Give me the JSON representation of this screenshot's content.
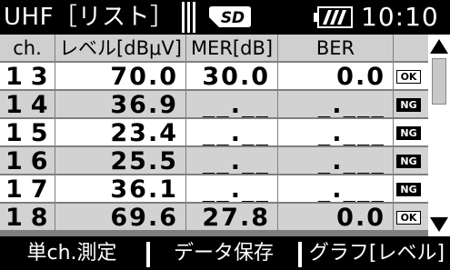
{
  "status_bar": {
    "title": "UHF［リスト］",
    "storage_icon": "sd-card-icon",
    "storage_label": "SD",
    "signal_icon": "signal-bars-icon",
    "battery_icon": "battery-icon",
    "time": "10:10"
  },
  "table": {
    "headers": [
      "ch.",
      "レベル[dBμV]",
      "MER[dB]",
      "BER",
      ""
    ],
    "rows": [
      {
        "ch": "13",
        "level": "70.0",
        "mer": "30.0",
        "ber": "0.0",
        "status": "OK"
      },
      {
        "ch": "14",
        "level": "36.9",
        "mer": "__.__",
        "ber": "_.___",
        "status": "NG"
      },
      {
        "ch": "15",
        "level": "23.4",
        "mer": "__.__",
        "ber": "_.___",
        "status": "NG"
      },
      {
        "ch": "16",
        "level": "25.5",
        "mer": "__.__",
        "ber": "_.___",
        "status": "NG"
      },
      {
        "ch": "17",
        "level": "36.1",
        "mer": "__.__",
        "ber": "_.___",
        "status": "NG"
      },
      {
        "ch": "18",
        "level": "69.6",
        "mer": "27.8",
        "ber": "0.0",
        "status": "OK"
      }
    ]
  },
  "scrollbar": {
    "up_icon": "scroll-up-arrow-icon",
    "down_icon": "scroll-down-arrow-icon",
    "thumb_start_fraction": 0.0,
    "thumb_end_fraction": 0.3
  },
  "softkeys": [
    "単ch.測定",
    "データ保存",
    "グラフ[レベル]"
  ],
  "colors": {
    "background": "#000000",
    "header_cell": "#cfcfcf",
    "row_light": "#ffffff",
    "row_dark": "#d2d2d2",
    "grid": "#7f7f7f",
    "ng_badge": "#000000",
    "ok_badge": "#ffffff"
  }
}
